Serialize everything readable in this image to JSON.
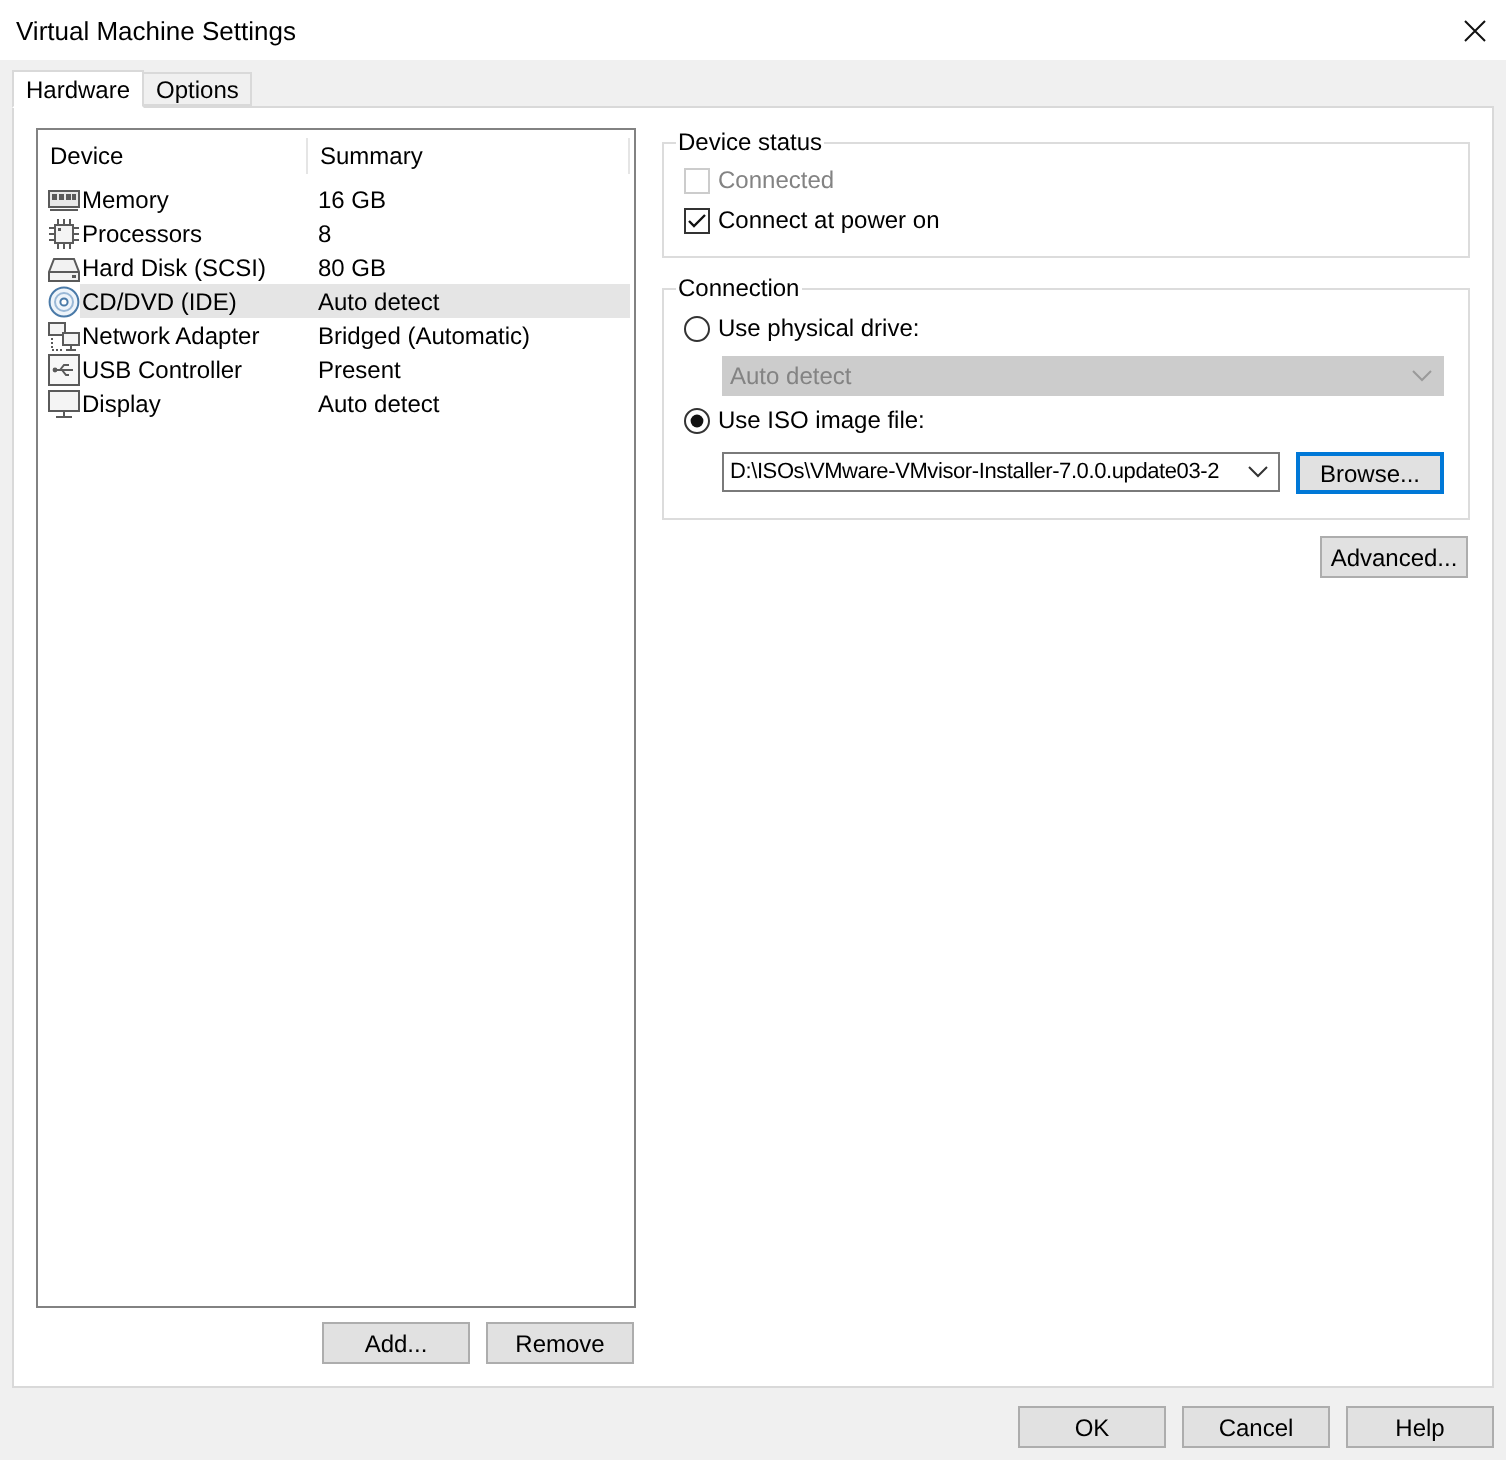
{
  "window": {
    "title": "Virtual Machine Settings"
  },
  "tabs": [
    {
      "label": "Hardware",
      "selected": true
    },
    {
      "label": "Options",
      "selected": false
    }
  ],
  "device_list": {
    "columns": [
      "Device",
      "Summary"
    ],
    "rows": [
      {
        "kind": "memory",
        "device": "Memory",
        "summary": "16 GB",
        "selected": false
      },
      {
        "kind": "processor",
        "device": "Processors",
        "summary": "8",
        "selected": false
      },
      {
        "kind": "disk",
        "device": "Hard Disk (SCSI)",
        "summary": "80 GB",
        "selected": false
      },
      {
        "kind": "cd",
        "device": "CD/DVD (IDE)",
        "summary": "Auto detect",
        "selected": true
      },
      {
        "kind": "network",
        "device": "Network Adapter",
        "summary": "Bridged (Automatic)",
        "selected": false
      },
      {
        "kind": "usb",
        "device": "USB Controller",
        "summary": "Present",
        "selected": false
      },
      {
        "kind": "display",
        "device": "Display",
        "summary": "Auto detect",
        "selected": false
      }
    ]
  },
  "device_list_buttons": [
    "Add...",
    "Remove"
  ],
  "device_status": {
    "title": "Device status",
    "checkboxes": [
      {
        "label": "Connected",
        "checked": false,
        "disabled": true
      },
      {
        "label": "Connect at power on",
        "checked": true,
        "disabled": false
      }
    ]
  },
  "connection": {
    "title": "Connection",
    "options": [
      {
        "label": "Use physical drive:",
        "selected": false,
        "field": {
          "value": "Auto detect",
          "disabled": true
        }
      },
      {
        "label": "Use ISO image file:",
        "selected": true,
        "field": {
          "value": "D:\\ISOs\\VMware-VMvisor-Installer-7.0.0.update03-2",
          "disabled": false
        },
        "button": {
          "label": "Browse...",
          "focused": true
        }
      }
    ]
  },
  "advanced_button": "Advanced...",
  "dialog_buttons": [
    "OK",
    "Cancel",
    "Help"
  ]
}
